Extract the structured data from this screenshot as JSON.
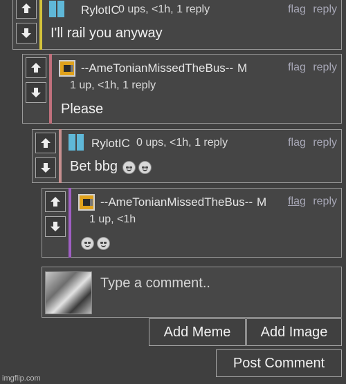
{
  "comments": [
    {
      "username": "RylotIC",
      "meta": "0 ups, <1h, 1 reply",
      "flag": "flag",
      "reply": "reply",
      "body": "I'll rail you anyway",
      "bar_color": "#d4c33b",
      "avatar_icon": "rylotic-avatar-icon"
    },
    {
      "username": "--AmeTonianMissedTheBus--",
      "badge": "M",
      "meta": "1 up, <1h, 1 reply",
      "flag": "flag",
      "reply": "reply",
      "body": "Please",
      "bar_color": "#c0707c",
      "avatar_icon": "ametonian-avatar-icon"
    },
    {
      "username": "RylotIC",
      "meta": "0 ups, <1h, 1 reply",
      "flag": "flag",
      "reply": "reply",
      "body": "Bet bbg",
      "body_emojis": [
        "cat-grin-emoji",
        "cat-smile-emoji"
      ],
      "bar_color": "#c68f8f",
      "avatar_icon": "rylotic-avatar-icon"
    },
    {
      "username": "--AmeTonianMissedTheBus--",
      "badge": "M",
      "meta": "1 up, <1h",
      "flag": "flag",
      "reply": "reply",
      "body_emojis": [
        "smiling-face-emoji",
        "relieved-face-emoji"
      ],
      "bar_color": "#a05fc4",
      "avatar_icon": "ametonian-avatar-icon"
    }
  ],
  "composer": {
    "placeholder": "Type a comment..",
    "add_meme": "Add Meme",
    "add_image": "Add Image",
    "post_comment": "Post Comment",
    "thumb_icon": "user-thumbnail-image"
  },
  "watermark": "imgflip.com",
  "icons": {
    "upvote": "arrow-up-icon",
    "downvote": "arrow-down-icon"
  }
}
